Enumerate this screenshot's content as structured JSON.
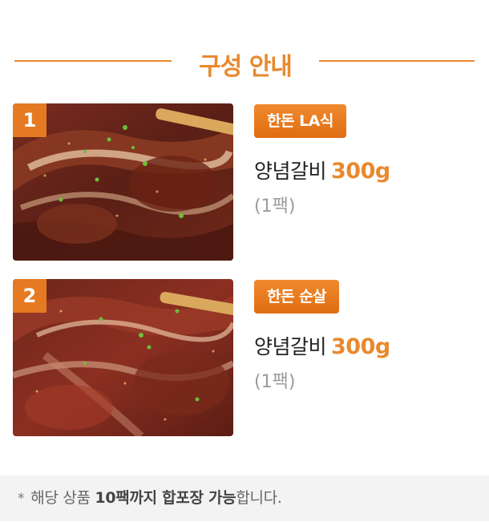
{
  "header": {
    "title": "구성 안내"
  },
  "colors": {
    "accent": "#e8892e",
    "badge": "#e57a22",
    "tag_top": "#f08a2e",
    "tag_bottom": "#e06d12",
    "notice_bg": "#f3f3f3"
  },
  "items": [
    {
      "number": "1",
      "tag": "한돈 LA식",
      "product_name": "양념갈비",
      "weight": "300g",
      "pack": "(1팩)"
    },
    {
      "number": "2",
      "tag": "한돈 순살",
      "product_name": "양념갈비",
      "weight": "300g",
      "pack": "(1팩)"
    }
  ],
  "notice": {
    "marker": "*",
    "prefix": "해당 상품 ",
    "bold1": "10팩까지 합포장 가능",
    "suffix": "합니다."
  }
}
